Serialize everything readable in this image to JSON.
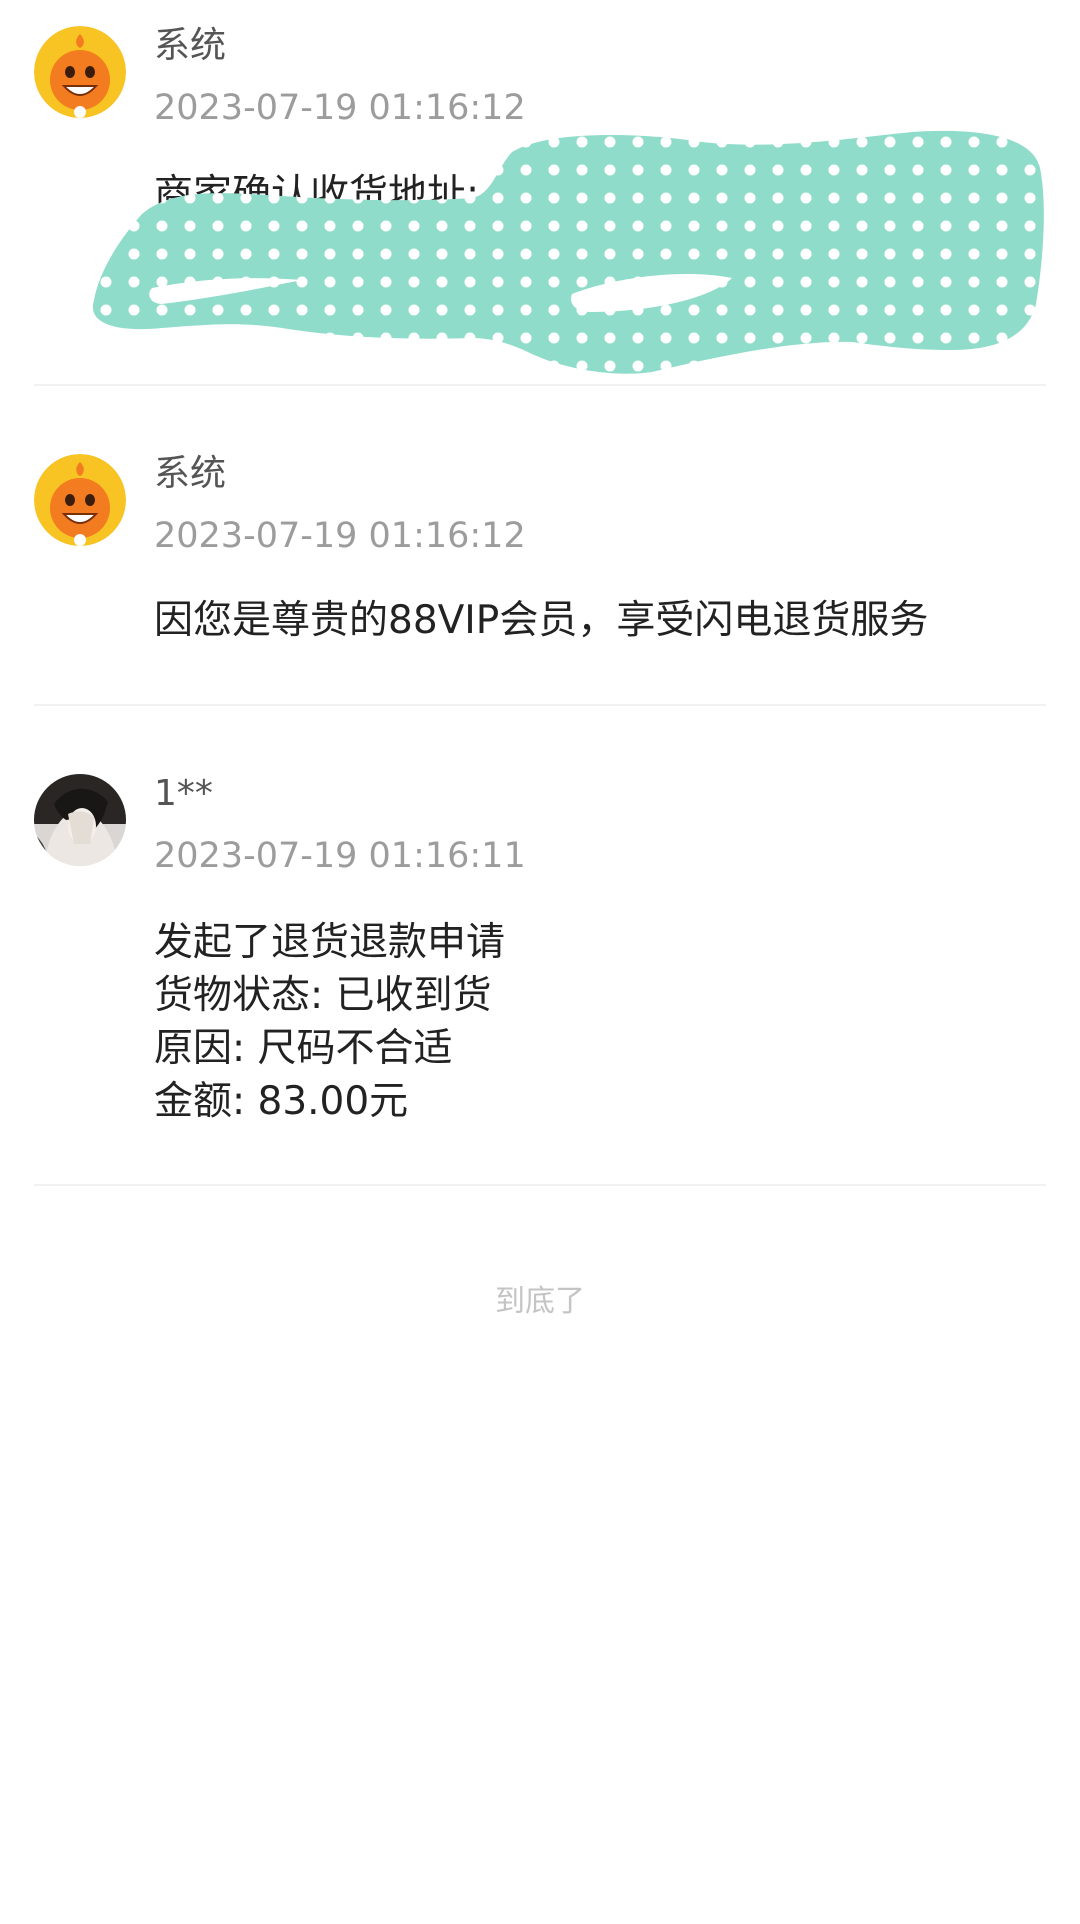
{
  "records": [
    {
      "sender": "系统",
      "time": "2023-07-19 01:16:12",
      "lines": [
        "商家确认收货地址:"
      ],
      "avatar_icon": "taobao-mascot-icon"
    },
    {
      "sender": "系统",
      "time": "2023-07-19 01:16:12",
      "lines": [
        "因您是尊贵的88VIP会员，享受闪电退货服务"
      ],
      "avatar_icon": "taobao-mascot-icon"
    },
    {
      "sender": "1**",
      "time": "2023-07-19 01:16:11",
      "lines": [
        "发起了退货退款申请",
        "货物状态: 已收到货",
        "原因: 尺码不合适",
        "金额: 83.00元"
      ],
      "avatar_icon": "user-photo-avatar"
    }
  ],
  "footer": {
    "end_text": "到底了"
  },
  "colors": {
    "redaction": "#8fdcca",
    "mascot_orange": "#f27c1f",
    "mascot_bg": "#f7c424"
  }
}
